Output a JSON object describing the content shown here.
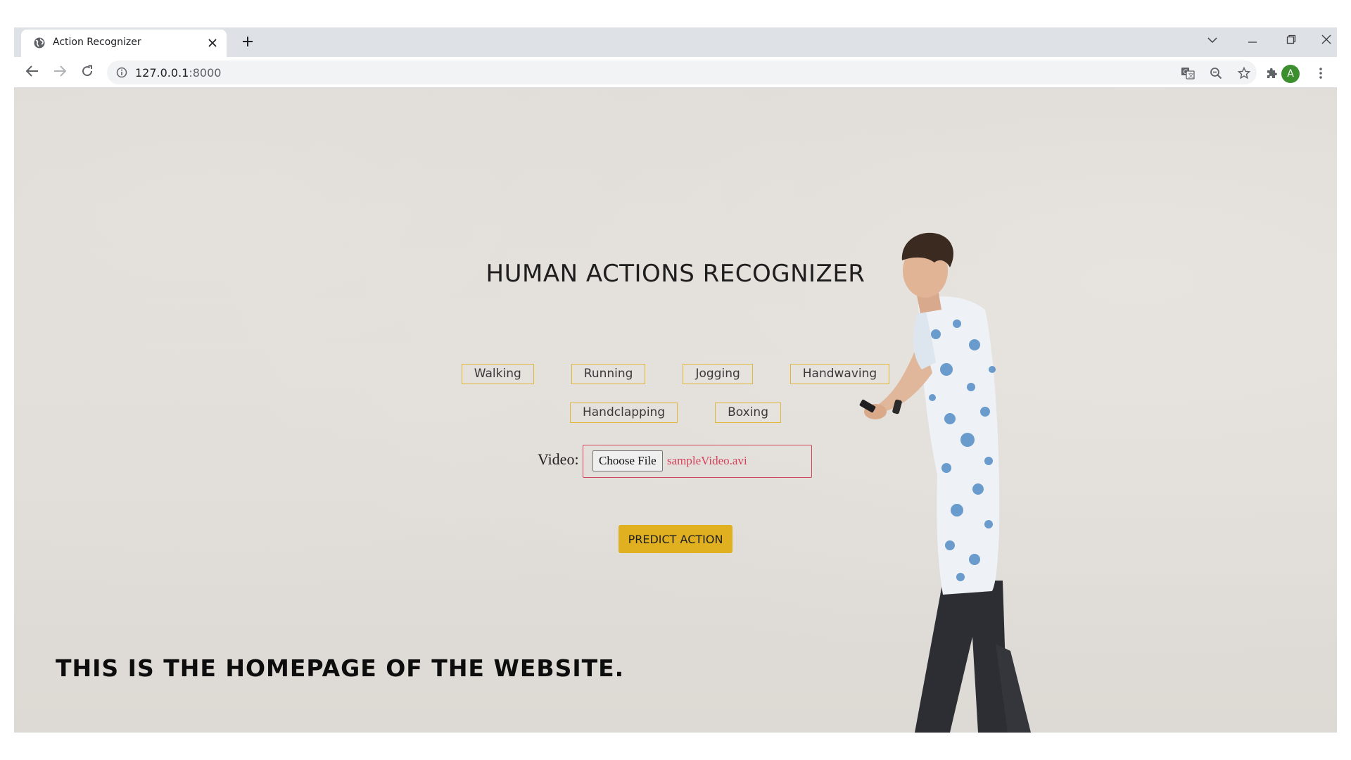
{
  "browser": {
    "tab_title": "Action Recognizer",
    "url_host": "127.0.0.1",
    "url_port": ":8000",
    "avatar_letter": "A"
  },
  "page": {
    "heading": "HUMAN ACTIONS RECOGNIZER",
    "actions_row1": [
      "Walking",
      "Running",
      "Jogging",
      "Handwaving"
    ],
    "actions_row2": [
      "Handclapping",
      "Boxing"
    ],
    "video_label": "Video:",
    "choose_file_label": "Choose File",
    "file_name": "sampleVideo.avi",
    "predict_label": "PREDICT ACTION",
    "caption": "THIS IS THE HOMEPAGE OF THE WEBSITE."
  },
  "icons": {
    "favicon": "globe-icon",
    "tab_close": "close-icon",
    "new_tab": "plus-icon",
    "tab_search": "chevron-down-icon",
    "minimize": "minimize-icon",
    "restore": "restore-icon",
    "close_window": "close-icon",
    "back": "back-arrow-icon",
    "forward": "forward-arrow-icon",
    "reload": "reload-icon",
    "site_info": "info-icon",
    "translate": "translate-icon",
    "zoom": "zoom-out-icon",
    "bookmark": "star-icon",
    "extensions": "puzzle-icon",
    "menu": "kebab-menu-icon"
  },
  "colors": {
    "accent_gold": "#e0b020",
    "chip_border": "#e0b73a",
    "file_box_border": "#d4455a",
    "file_name_text": "#d6405a",
    "avatar_bg": "#3c8e2f"
  }
}
